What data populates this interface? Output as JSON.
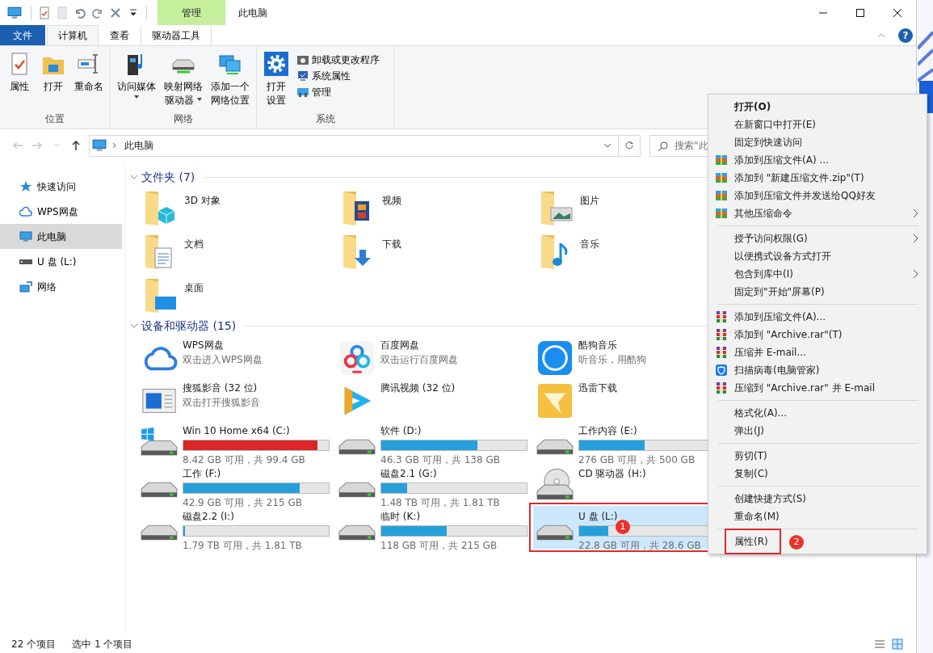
{
  "window": {
    "title": "此电脑",
    "context_tab": "管理"
  },
  "ribbon": {
    "tabs": [
      {
        "label": "文件",
        "kind": "file",
        "selected": false
      },
      {
        "label": "计算机",
        "kind": "normal",
        "selected": true
      },
      {
        "label": "查看",
        "kind": "normal",
        "selected": false
      },
      {
        "label": "驱动器工具",
        "kind": "contextual",
        "selected": false
      }
    ],
    "help_label": "?",
    "groups": [
      {
        "label": "位置",
        "buttons": [
          {
            "lines": [
              "属性"
            ],
            "dropdown": false
          },
          {
            "lines": [
              "打开"
            ],
            "dropdown": false
          },
          {
            "lines": [
              "重命名"
            ],
            "dropdown": false
          }
        ]
      },
      {
        "label": "网络",
        "buttons": [
          {
            "lines": [
              "访问媒体"
            ],
            "dropdown": true
          },
          {
            "lines": [
              "映射网络",
              "驱动器"
            ],
            "dropdown": true
          },
          {
            "lines": [
              "添加一个",
              "网络位置"
            ],
            "dropdown": false
          }
        ]
      },
      {
        "label": "系统",
        "buttons": [
          {
            "lines": [
              "打开",
              "设置"
            ],
            "dropdown": false
          }
        ],
        "small_buttons": [
          {
            "label": "卸载或更改程序"
          },
          {
            "label": "系统属性"
          },
          {
            "label": "管理"
          }
        ]
      }
    ]
  },
  "address_bar": {
    "nav_buttons": [
      {
        "kind": "back",
        "disabled": true
      },
      {
        "kind": "forward",
        "disabled": true
      },
      {
        "kind": "recent",
        "disabled": true
      },
      {
        "kind": "up",
        "disabled": false
      }
    ],
    "path": "此电脑",
    "search": {
      "placeholder": "搜索\"此"
    }
  },
  "navigation": [
    {
      "label": "快速访问",
      "kind": "star",
      "selected": false
    },
    {
      "label": "WPS网盘",
      "kind": "cloud",
      "selected": false
    },
    {
      "label": "此电脑",
      "kind": "pc",
      "selected": true
    },
    {
      "label": "U 盘 (L:)",
      "kind": "usb",
      "selected": false
    },
    {
      "label": "网络",
      "kind": "network",
      "selected": false
    }
  ],
  "sections": [
    {
      "title": "文件夹 (7)",
      "expanded": true,
      "items": [
        {
          "kind": "folder",
          "name": "3D 对象",
          "selected": false
        },
        {
          "kind": "folder",
          "name": "视频",
          "selected": false
        },
        {
          "kind": "folder",
          "name": "图片",
          "selected": false
        },
        {
          "kind": "folder",
          "name": "文档",
          "selected": false
        },
        {
          "kind": "folder",
          "name": "下载",
          "selected": false
        },
        {
          "kind": "folder",
          "name": "音乐",
          "selected": false
        },
        {
          "kind": "folder",
          "name": "桌面",
          "selected": false
        }
      ]
    },
    {
      "title": "设备和驱动器 (15)",
      "expanded": true,
      "items": [
        {
          "kind": "app",
          "name": "WPS网盘",
          "subtitle": "双击进入WPS网盘",
          "selected": false
        },
        {
          "kind": "app",
          "name": "百度网盘",
          "subtitle": "双击运行百度网盘",
          "selected": false
        },
        {
          "kind": "app",
          "name": "酷狗音乐",
          "subtitle": "听音乐，用酷狗",
          "selected": false
        },
        {
          "kind": "app",
          "name": "搜狐影音 (32 位)",
          "subtitle": "双击打开搜狐影音",
          "selected": false
        },
        {
          "kind": "app",
          "name": "腾讯视频 (32 位)",
          "selected": false
        },
        {
          "kind": "app",
          "name": "迅雷下载",
          "selected": false
        },
        {
          "kind": "system_drive",
          "name": "Win 10 Home x64 (C:)",
          "level": 0.92,
          "low_space": true,
          "reading": "8.42 GB 可用，共 99.4 GB",
          "selected": false
        },
        {
          "kind": "drive",
          "name": "软件 (D:)",
          "level": 0.66,
          "low_space": false,
          "reading": "46.3 GB 可用，共 138 GB",
          "selected": false
        },
        {
          "kind": "drive",
          "name": "工作内容 (E:)",
          "level": 0.45,
          "low_space": false,
          "reading": "276 GB 可用，共 500 GB",
          "selected": false
        },
        {
          "kind": "drive",
          "name": "工作 (F:)",
          "level": 0.8,
          "low_space": false,
          "reading": "42.9 GB 可用，共 215 GB",
          "selected": false
        },
        {
          "kind": "drive",
          "name": "磁盘2.1 (G:)",
          "level": 0.18,
          "low_space": false,
          "reading": "1.48 TB 可用，共 1.81 TB",
          "selected": false
        },
        {
          "kind": "cd",
          "name": "CD 驱动器 (H:)",
          "selected": false
        },
        {
          "kind": "drive",
          "name": "磁盘2.2 (I:)",
          "level": 0.01,
          "low_space": false,
          "reading": "1.79 TB 可用，共 1.81 TB",
          "selected": false
        },
        {
          "kind": "drive",
          "name": "临时 (K:)",
          "level": 0.45,
          "low_space": false,
          "reading": "118 GB 可用，共 215 GB",
          "selected": false
        },
        {
          "kind": "drive",
          "name": "U 盘 (L:)",
          "level": 0.2,
          "low_space": false,
          "reading": "22.8 GB 可用，共 28.6 GB",
          "selected": true,
          "annotation": "1"
        }
      ]
    }
  ],
  "context_menu": {
    "groups": [
      [
        {
          "label": "打开(O)",
          "kind": "plain",
          "default": true,
          "submenu": false
        },
        {
          "label": "在新窗口中打开(E)",
          "kind": "plain",
          "default": false,
          "submenu": false
        },
        {
          "label": "固定到快速访问",
          "kind": "plain",
          "default": false,
          "submenu": false
        },
        {
          "label": "添加到压缩文件(A) ...",
          "kind": "zip",
          "default": false,
          "submenu": false
        },
        {
          "label": "添加到 \"新建压缩文件.zip\"(T)",
          "kind": "zip",
          "default": false,
          "submenu": false
        },
        {
          "label": "添加到压缩文件并发送给QQ好友",
          "kind": "zip",
          "default": false,
          "submenu": false
        },
        {
          "label": "其他压缩命令",
          "kind": "zip",
          "default": false,
          "submenu": true
        }
      ],
      [
        {
          "label": "授予访问权限(G)",
          "kind": "plain",
          "default": false,
          "submenu": true
        },
        {
          "label": "以便携式设备方式打开",
          "kind": "plain",
          "default": false,
          "submenu": false
        },
        {
          "label": "包含到库中(I)",
          "kind": "plain",
          "default": false,
          "submenu": true
        },
        {
          "label": "固定到\"开始\"屏幕(P)",
          "kind": "plain",
          "default": false,
          "submenu": false
        }
      ],
      [
        {
          "label": "添加到压缩文件(A)...",
          "kind": "rar",
          "default": false,
          "submenu": false
        },
        {
          "label": "添加到 \"Archive.rar\"(T)",
          "kind": "rar",
          "default": false,
          "submenu": false
        },
        {
          "label": "压缩并 E-mail...",
          "kind": "rar",
          "default": false,
          "submenu": false
        },
        {
          "label": "扫描病毒(电脑管家)",
          "kind": "antivirus",
          "default": false,
          "submenu": false
        },
        {
          "label": "压缩到 \"Archive.rar\" 并 E-mail",
          "kind": "rar",
          "default": false,
          "submenu": false
        }
      ],
      [
        {
          "label": "格式化(A)...",
          "kind": "plain",
          "default": false,
          "submenu": false
        },
        {
          "label": "弹出(J)",
          "kind": "plain",
          "default": false,
          "submenu": false
        }
      ],
      [
        {
          "label": "剪切(T)",
          "kind": "plain",
          "default": false,
          "submenu": false
        },
        {
          "label": "复制(C)",
          "kind": "plain",
          "default": false,
          "submenu": false
        }
      ],
      [
        {
          "label": "创建快捷方式(S)",
          "kind": "plain",
          "default": false,
          "submenu": false
        },
        {
          "label": "重命名(M)",
          "kind": "plain",
          "default": false,
          "submenu": false
        }
      ],
      [
        {
          "label": "属性(R)",
          "kind": "plain",
          "default": false,
          "submenu": false,
          "annotation": "2"
        }
      ]
    ]
  },
  "status_bar": {
    "item_count": "22 个项目",
    "selection": "选中 1 个项目"
  }
}
